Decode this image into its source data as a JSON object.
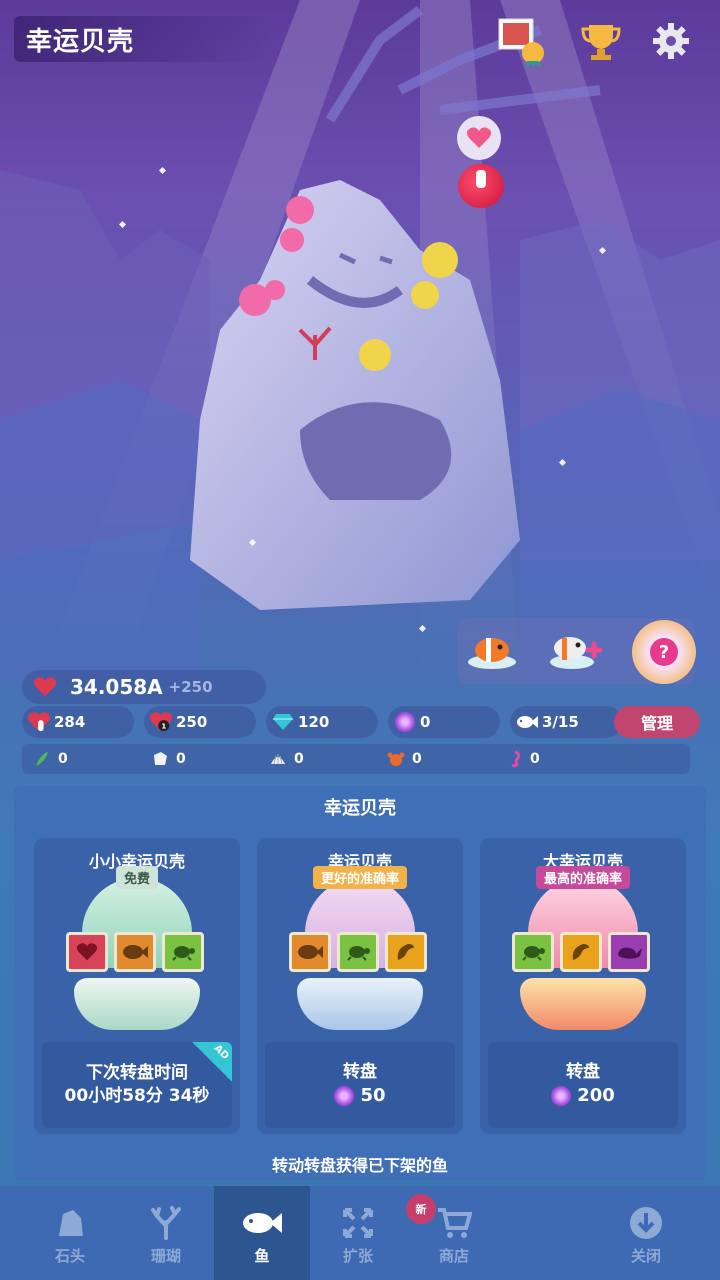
{
  "header": {
    "title": "幸运贝壳"
  },
  "top_icons": [
    "gallery-badge-icon",
    "trophy-icon",
    "gear-icon"
  ],
  "stats": {
    "vitality": "34.058A",
    "vitality_rate": "+250",
    "tap_power": "284",
    "per_sec": "250",
    "diamonds": "120",
    "pearls": "0",
    "fish_count": "3/15",
    "manage_label": "管理"
  },
  "resources": [
    "0",
    "0",
    "0",
    "0",
    "0"
  ],
  "panel": {
    "title": "幸运贝壳",
    "footer": "转动转盘获得已下架的鱼",
    "cards": [
      {
        "name": "小小幸运贝壳",
        "ribbon": "免费",
        "slots": [
          "heart-icon",
          "fish-icon",
          "turtle-icon"
        ],
        "line1": "下次转盘时间",
        "line2": "00小时58分 34秒",
        "ad": "AD"
      },
      {
        "name": "幸运贝壳",
        "ribbon": "更好的准确率",
        "slots": [
          "fish-icon",
          "turtle-icon",
          "dolphin-icon"
        ],
        "line1": "转盘",
        "cost": "50"
      },
      {
        "name": "大幸运贝壳",
        "ribbon": "最高的准确率",
        "slots": [
          "turtle-icon",
          "dolphin-icon",
          "whale-icon"
        ],
        "line1": "转盘",
        "cost": "200"
      }
    ]
  },
  "tabs": [
    {
      "label": "石头",
      "icon": "rock-icon"
    },
    {
      "label": "珊瑚",
      "icon": "coral-icon"
    },
    {
      "label": "鱼",
      "icon": "fish-icon",
      "active": true
    },
    {
      "label": "扩张",
      "icon": "expand-icon"
    },
    {
      "label": "商店",
      "icon": "cart-icon",
      "badge": "新"
    },
    {
      "label": "",
      "icon": ""
    },
    {
      "label": "关闭",
      "icon": "download-icon"
    }
  ],
  "colors": {
    "accent": "#c0466f",
    "panel": "#3f6fb6",
    "tabbar": "#3d6ab2"
  }
}
